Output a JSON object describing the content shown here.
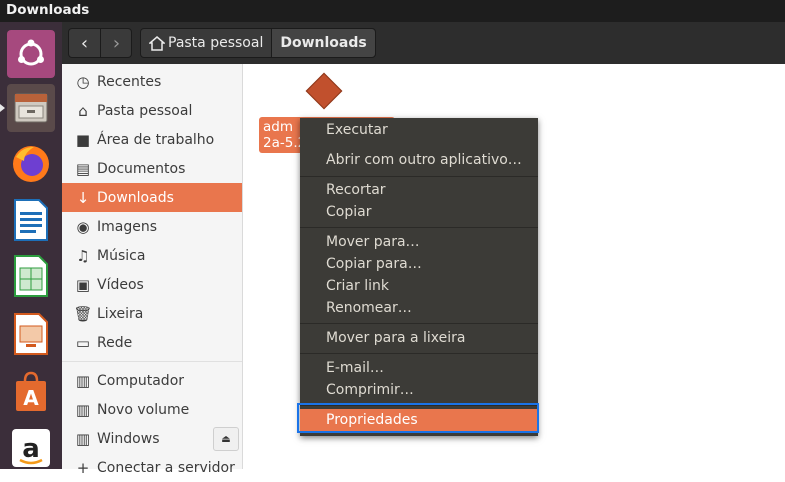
{
  "window": {
    "title": "Downloads"
  },
  "toolbar": {
    "back": "‹",
    "forward": "›",
    "breadcrumbs": [
      {
        "label": "Pasta pessoal"
      },
      {
        "label": "Downloads"
      }
    ]
  },
  "sidebar": {
    "items": [
      {
        "label": "Recentes",
        "icon": "clock-icon"
      },
      {
        "label": "Pasta pessoal",
        "icon": "home-icon"
      },
      {
        "label": "Área de trabalho",
        "icon": "folder-icon"
      },
      {
        "label": "Documentos",
        "icon": "document-icon"
      },
      {
        "label": "Downloads",
        "icon": "download-icon"
      },
      {
        "label": "Imagens",
        "icon": "camera-icon"
      },
      {
        "label": "Música",
        "icon": "music-icon"
      },
      {
        "label": "Vídeos",
        "icon": "film-icon"
      },
      {
        "label": "Lixeira",
        "icon": "trash-icon"
      },
      {
        "label": "Rede",
        "icon": "network-icon"
      },
      {
        "label": "Computador",
        "icon": "drive-icon"
      },
      {
        "label": "Novo volume",
        "icon": "drive-icon"
      },
      {
        "label": "Windows",
        "icon": "drive-icon"
      },
      {
        "label": "Conectar a servidor",
        "icon": "plus-icon"
      }
    ]
  },
  "file": {
    "name_line1": "adm",
    "name_line2": "2a-5.2"
  },
  "context_menu": {
    "items": [
      "Executar",
      "Abrir com outro aplicativo…",
      "Recortar",
      "Copiar",
      "Mover para…",
      "Copiar para…",
      "Criar link",
      "Renomear…",
      "Mover para a lixeira",
      "E-mail…",
      "Comprimir…",
      "Propriedades"
    ]
  },
  "colors": {
    "accent": "#e9764d",
    "launcher": "#3b2e3a",
    "menu": "#3c3b37",
    "focus": "#1a73e8"
  }
}
